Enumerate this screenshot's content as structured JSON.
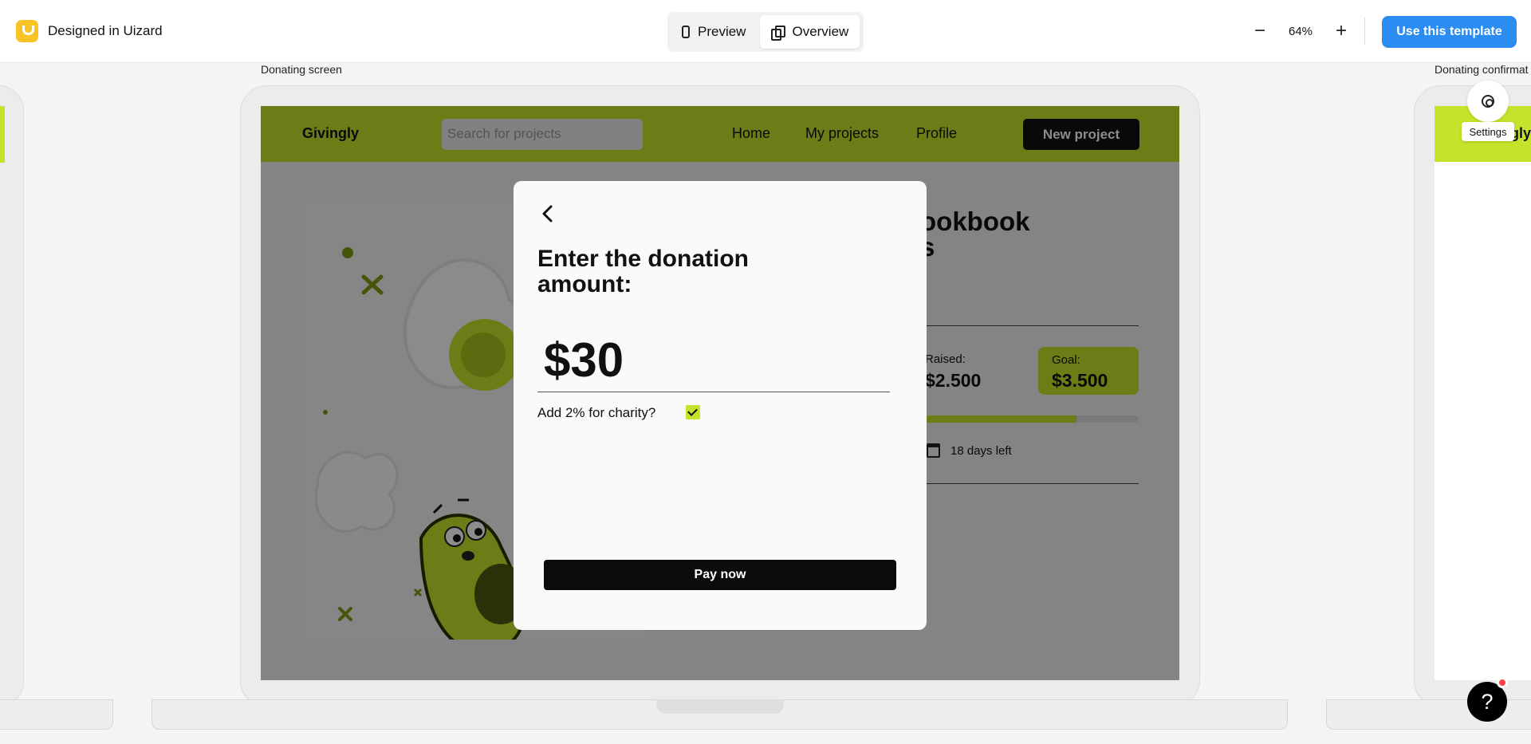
{
  "app": {
    "title": "Designed in Uizard"
  },
  "view_switcher": {
    "preview": "Preview",
    "overview": "Overview"
  },
  "zoom": {
    "level": "64%"
  },
  "toolbar": {
    "cta": "Use this template"
  },
  "frames": {
    "center_label": "Donating screen",
    "right_label": "Donating confirmat"
  },
  "site": {
    "brand": "Givingly",
    "search_placeholder": "Search for projects",
    "nav": [
      "Home",
      "My projects",
      "Profile"
    ],
    "new_project": "New project"
  },
  "project": {
    "title_line1": "ookbook",
    "title_line2": "s",
    "raised_label": "Raised:",
    "raised_value": "$2.500",
    "goal_label": "Goal:",
    "goal_value": "$3.500",
    "progress_pct": 71,
    "days_left": "18 days left"
  },
  "modal": {
    "title": "Enter the donation amount:",
    "amount": "$30",
    "charity_label": "Add 2% for charity?",
    "charity_checked": true,
    "pay_label": "Pay now"
  },
  "settings": {
    "tooltip": "Settings"
  },
  "right_frame": {
    "brand_fragment": "gly"
  },
  "help": {
    "label": "?"
  },
  "colors": {
    "accent": "#c7e22b",
    "cta": "#2b8cf1",
    "logo": "#f7c325",
    "button_dark": "#111111"
  }
}
